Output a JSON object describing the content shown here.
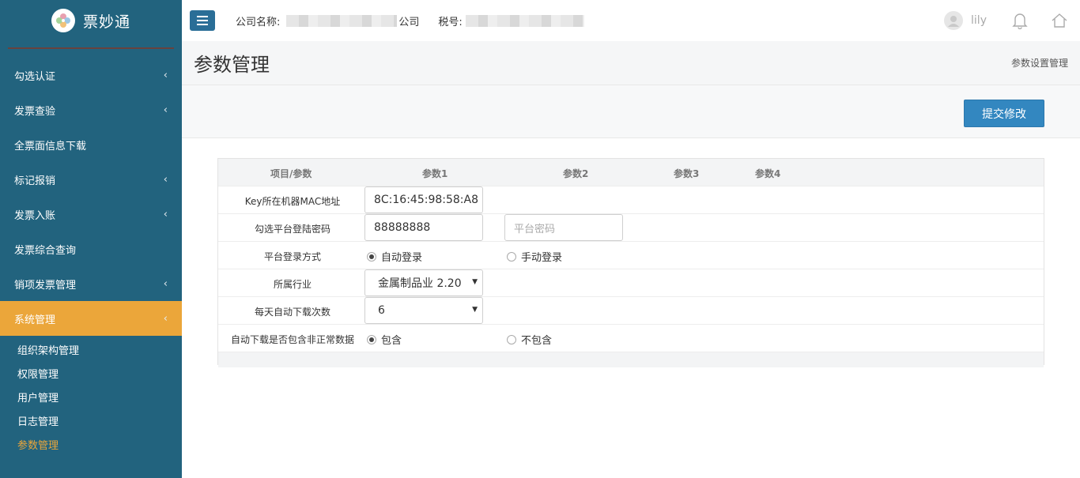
{
  "app": {
    "name": "票妙通"
  },
  "sidebar": {
    "items": [
      {
        "label": "勾选认证",
        "has_children": true
      },
      {
        "label": "发票查验",
        "has_children": true
      },
      {
        "label": "全票面信息下载",
        "has_children": false
      },
      {
        "label": "标记报销",
        "has_children": true
      },
      {
        "label": "发票入账",
        "has_children": true
      },
      {
        "label": "发票综合查询",
        "has_children": false
      },
      {
        "label": "销项发票管理",
        "has_children": true
      },
      {
        "label": "系统管理",
        "has_children": true,
        "active": true
      }
    ],
    "submenu": [
      {
        "label": "组织架构管理"
      },
      {
        "label": "权限管理"
      },
      {
        "label": "用户管理"
      },
      {
        "label": "日志管理"
      },
      {
        "label": "参数管理",
        "current": true
      }
    ],
    "chevron": "‹"
  },
  "topbar": {
    "company_label": "公司名称:",
    "company_suffix": "公司",
    "tax_label": "税号:",
    "username": "lily"
  },
  "page": {
    "title": "参数管理",
    "breadcrumb": "参数设置管理",
    "submit_label": "提交修改"
  },
  "table": {
    "headers": [
      "项目/参数",
      "参数1",
      "参数2",
      "参数3",
      "参数4"
    ],
    "rows": {
      "mac": {
        "label": "Key所在机器MAC地址",
        "value": "8C:16:45:98:58:A8"
      },
      "password": {
        "label": "勾选平台登陆密码",
        "value": "88888888",
        "placeholder2": "平台密码"
      },
      "login": {
        "label": "平台登录方式",
        "option1": "自动登录",
        "option2": "手动登录",
        "selected": "自动登录"
      },
      "industry": {
        "label": "所属行业",
        "value": "金属制品业 2.20"
      },
      "downloads": {
        "label": "每天自动下载次数",
        "value": "6"
      },
      "abnormal": {
        "label": "自动下载是否包含非正常数据",
        "option1": "包含",
        "option2": "不包含",
        "selected": "包含"
      }
    }
  },
  "colors": {
    "sidebar_bg": "#22637e",
    "accent": "#eba63a",
    "primary_button": "#3387c0"
  },
  "icons": {
    "menu": "hamburger-icon",
    "notification": "bell-icon",
    "home": "home-icon",
    "caret": "caret-down-icon"
  }
}
